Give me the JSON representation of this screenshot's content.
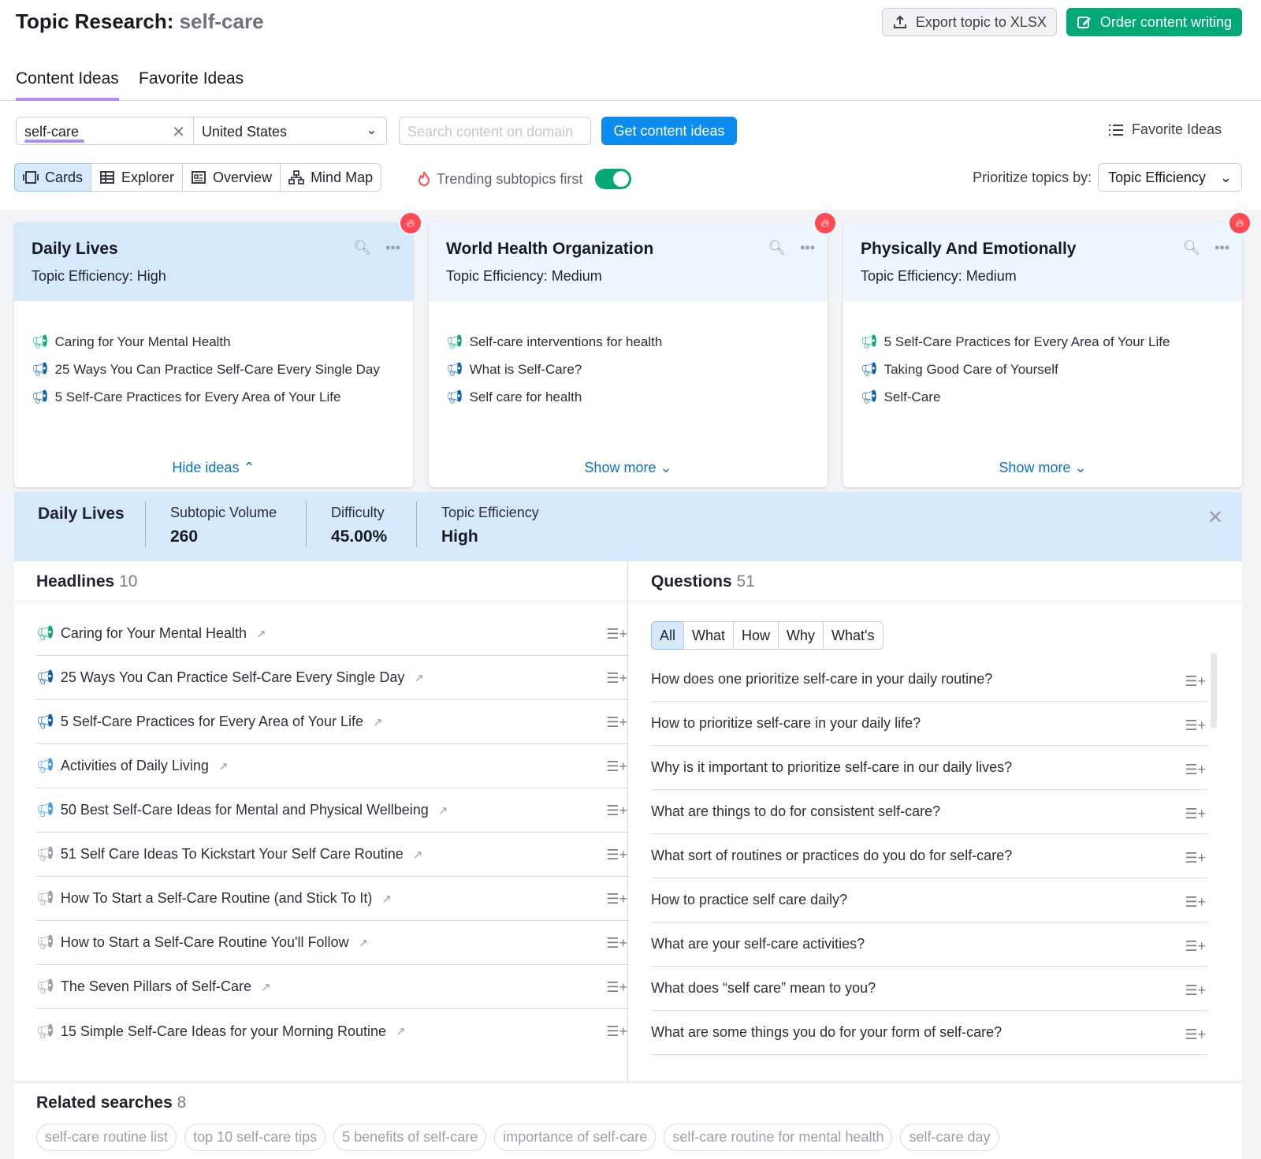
{
  "header": {
    "title_prefix": "Topic Research:",
    "keyword": "self-care"
  },
  "top_buttons": {
    "export_label": "Export topic to XLSX",
    "order_label": "Order content writing"
  },
  "tabs": [
    {
      "label": "Content Ideas"
    },
    {
      "label": "Favorite Ideas"
    }
  ],
  "controls": {
    "keyword_value": "self-care",
    "country_value": "United States",
    "domain_placeholder": "Search content on domain",
    "get_ideas_label": "Get content ideas",
    "favorite_ideas_label": "Favorite Ideas"
  },
  "views": [
    {
      "label": "Cards",
      "icon": "cards-icon"
    },
    {
      "label": "Explorer",
      "icon": "table-icon"
    },
    {
      "label": "Overview",
      "icon": "overview-icon"
    },
    {
      "label": "Mind Map",
      "icon": "mindmap-icon"
    }
  ],
  "trending_label": "Trending subtopics first",
  "prioritize": {
    "label": "Prioritize topics by:",
    "value": "Topic Efficiency"
  },
  "colors": {
    "accent_green": "#00a976",
    "accent_blue": "#0a8cf0",
    "purple": "#b08cff",
    "fire_red": "#ff4953"
  },
  "cards": [
    {
      "title": "Daily Lives",
      "efficiency": "Topic Efficiency: High",
      "items": [
        "Caring for Your Mental Health",
        "25 Ways You Can Practice Self-Care Every Single Day",
        "5 Self-Care Practices for Every Area of Your Life"
      ],
      "more_label": "Hide ideas"
    },
    {
      "title": "World Health Organization",
      "efficiency": "Topic Efficiency: Medium",
      "items": [
        "Self-care interventions for health",
        "What is Self-Care?",
        "Self care for health"
      ],
      "more_label": "Show more"
    },
    {
      "title": "Physically And Emotionally",
      "efficiency": "Topic Efficiency: Medium",
      "items": [
        "5 Self-Care Practices for Every Area of Your Life",
        "Taking Good Care of Yourself",
        "Self-Care"
      ],
      "more_label": "Show more"
    }
  ],
  "detail": {
    "name": "Daily Lives",
    "subtopic_volume_label": "Subtopic Volume",
    "subtopic_volume": "260",
    "difficulty_label": "Difficulty",
    "difficulty": "45.00%",
    "efficiency_label": "Topic Efficiency",
    "efficiency": "High"
  },
  "headlines": {
    "title": "Headlines",
    "count": "10",
    "items": [
      "Caring for Your Mental Health",
      "25 Ways You Can Practice Self-Care Every Single Day",
      "5 Self-Care Practices for Every Area of Your Life",
      "Activities of Daily Living",
      "50 Best Self-Care Ideas for Mental and Physical Wellbeing",
      "51 Self Care Ideas To Kickstart Your Self Care Routine",
      "How To Start a Self-Care Routine (and Stick To It)",
      "How to Start a Self-Care Routine You'll Follow",
      "The Seven Pillars of Self-Care",
      "15 Simple Self-Care Ideas for your Morning Routine"
    ]
  },
  "questions": {
    "title": "Questions",
    "count": "51",
    "filters": [
      "All",
      "What",
      "How",
      "Why",
      "What's"
    ],
    "items": [
      "How does one prioritize self-care in your daily routine?",
      "How to prioritize self-care in your daily life?",
      "Why is it important to prioritize self-care in our daily lives?",
      "What are things to do for consistent self-care?",
      "What sort of routines or practices do you do for self-care?",
      "How to practice self care daily?",
      "What are your self-care activities?",
      "What does “self care” mean to you?",
      "What are some things you do for your form of self-care?"
    ]
  },
  "related": {
    "title": "Related searches",
    "count": "8",
    "chips": [
      "self-care routine list",
      "top 10 self-care tips",
      "5 benefits of self-care",
      "importance of self-care",
      "self-care routine for mental health",
      "self-care day"
    ]
  }
}
